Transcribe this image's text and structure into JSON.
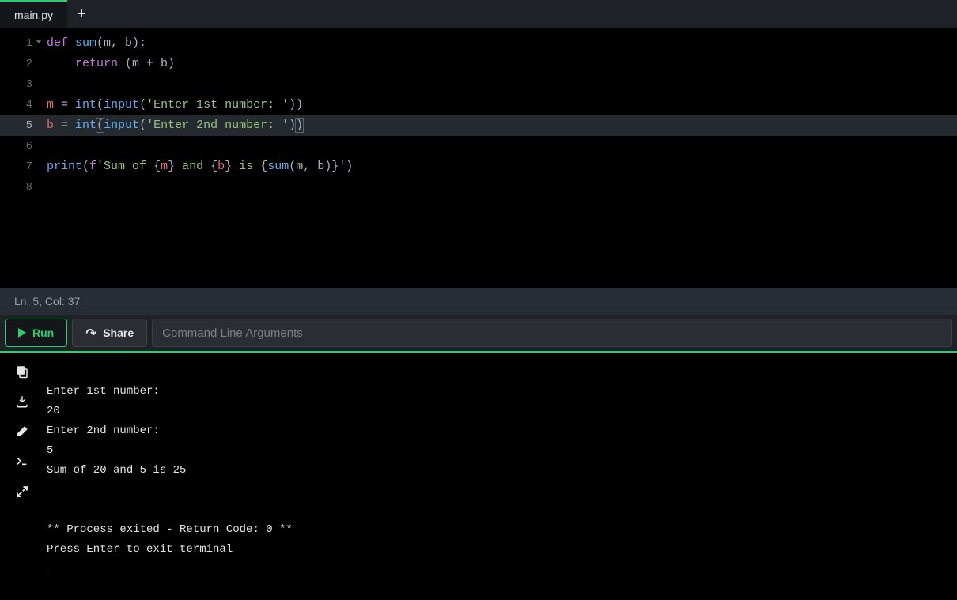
{
  "tabs": {
    "active": "main.py"
  },
  "code": {
    "lines": [
      1,
      2,
      3,
      4,
      5,
      6,
      7,
      8
    ],
    "active_line": 5,
    "line1": {
      "def": "def",
      "fname": "sum",
      "sig": "(m, b):"
    },
    "line2": {
      "ret": "return",
      "expr": "(m + b)"
    },
    "line4": {
      "v": "m",
      "eq": " = ",
      "int": "int",
      "op": "(",
      "inp": "input",
      "paren": "(",
      "s": "'Enter 1st number: '",
      "close": "))"
    },
    "line5": {
      "v": "b",
      "eq": " = ",
      "int": "int",
      "op": "(",
      "inp": "input",
      "paren": "(",
      "s": "'Enter 2nd number: '",
      "close1": ")",
      "close2": ")"
    },
    "line7": {
      "print": "print",
      "op": "(",
      "f": "f",
      "s1": "'Sum of ",
      "ob1": "{",
      "v1": "m",
      "cb1": "}",
      "s2": " and ",
      "ob2": "{",
      "v2": "b",
      "cb2": "}",
      "s3": " is ",
      "ob3": "{",
      "sum": "sum",
      "args": "(m, b)",
      "cb3": "}",
      "s4": "'",
      "cp": ")"
    }
  },
  "status": {
    "text": "Ln: 5,  Col: 37"
  },
  "toolbar": {
    "run_label": "Run",
    "share_label": "Share",
    "cmd_placeholder": "Command Line Arguments"
  },
  "terminal": {
    "lines": [
      "Enter 1st number: ",
      "20",
      "Enter 2nd number: ",
      "5",
      "Sum of 20 and 5 is 25",
      "",
      "",
      "** Process exited - Return Code: 0 **",
      "Press Enter to exit terminal"
    ]
  }
}
